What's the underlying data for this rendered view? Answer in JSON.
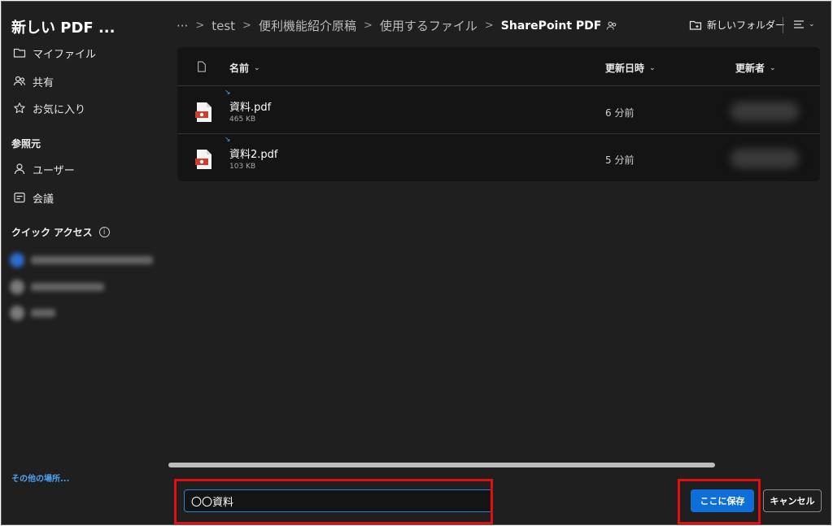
{
  "sidebar": {
    "title": "新しい PDF ...",
    "items": [
      {
        "label": "マイファイル",
        "icon": "folder-icon"
      },
      {
        "label": "共有",
        "icon": "people-icon"
      },
      {
        "label": "お気に入り",
        "icon": "star-icon"
      }
    ],
    "browse_heading": "参照元",
    "browse_items": [
      {
        "label": "ユーザー",
        "icon": "person-icon"
      },
      {
        "label": "会議",
        "icon": "calendar-icon"
      }
    ],
    "quick_access_heading": "クイック アクセス",
    "other_locations": "その他の場所..."
  },
  "breadcrumb": {
    "ellipsis": "···",
    "items": [
      "test",
      "便利機能紹介原稿",
      "使用するファイル"
    ],
    "current": "SharePoint PDF"
  },
  "toolbar": {
    "new_folder": "新しいフォルダー"
  },
  "table": {
    "headers": {
      "name": "名前",
      "modified": "更新日時",
      "modified_by": "更新者"
    },
    "rows": [
      {
        "name": "資料.pdf",
        "size": "465 KB",
        "modified": "6 分前"
      },
      {
        "name": "資料2.pdf",
        "size": "103 KB",
        "modified": "5 分前"
      }
    ]
  },
  "footer": {
    "filename_value": "〇〇資料",
    "save_label": "ここに保存",
    "cancel_label": "キャンセル"
  },
  "colors": {
    "accent": "#0f6fd8",
    "highlight": "#e01010",
    "background": "#1f1f1f"
  }
}
